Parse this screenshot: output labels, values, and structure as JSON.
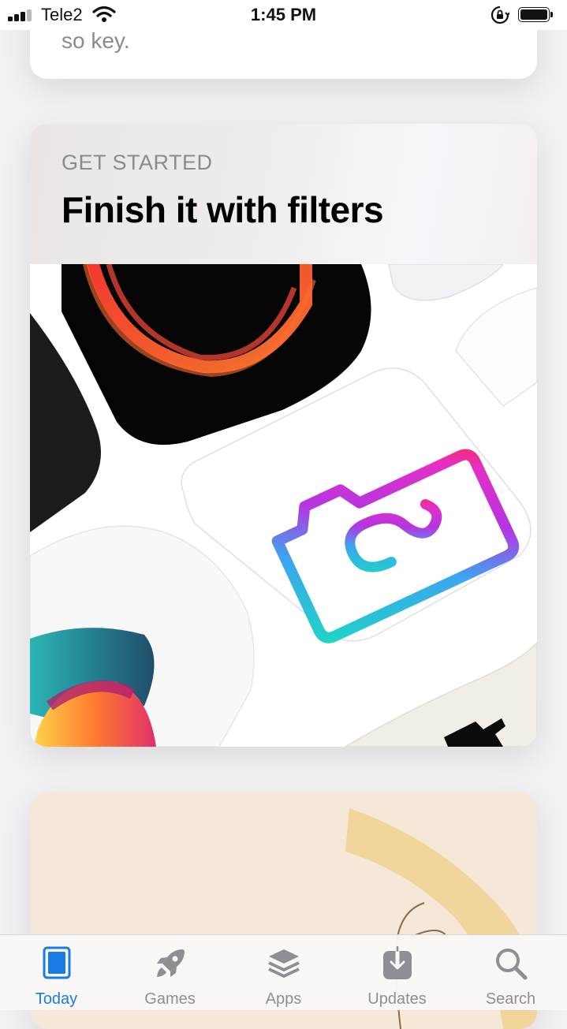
{
  "status_bar": {
    "carrier": "Tele2",
    "time": "1:45 PM",
    "signal_bars": 4,
    "signal_filled": 3,
    "battery_level": 0.9,
    "icons": [
      "signal-icon",
      "wifi-icon",
      "rotation-lock-icon",
      "battery-icon"
    ]
  },
  "previous_card": {
    "text": "so key."
  },
  "feature_card": {
    "eyebrow": "GET STARTED",
    "title": "Finish it with filters",
    "artwork": "app-icons-collage"
  },
  "tab_bar": {
    "active_color": "#1a7ae6",
    "inactive_color": "#8e8e93",
    "tabs": [
      {
        "label": "Today",
        "icon": "today-icon",
        "active": true
      },
      {
        "label": "Games",
        "icon": "rocket-icon",
        "active": false
      },
      {
        "label": "Apps",
        "icon": "layers-icon",
        "active": false
      },
      {
        "label": "Updates",
        "icon": "download-icon",
        "active": false
      },
      {
        "label": "Search",
        "icon": "search-icon",
        "active": false
      }
    ]
  }
}
